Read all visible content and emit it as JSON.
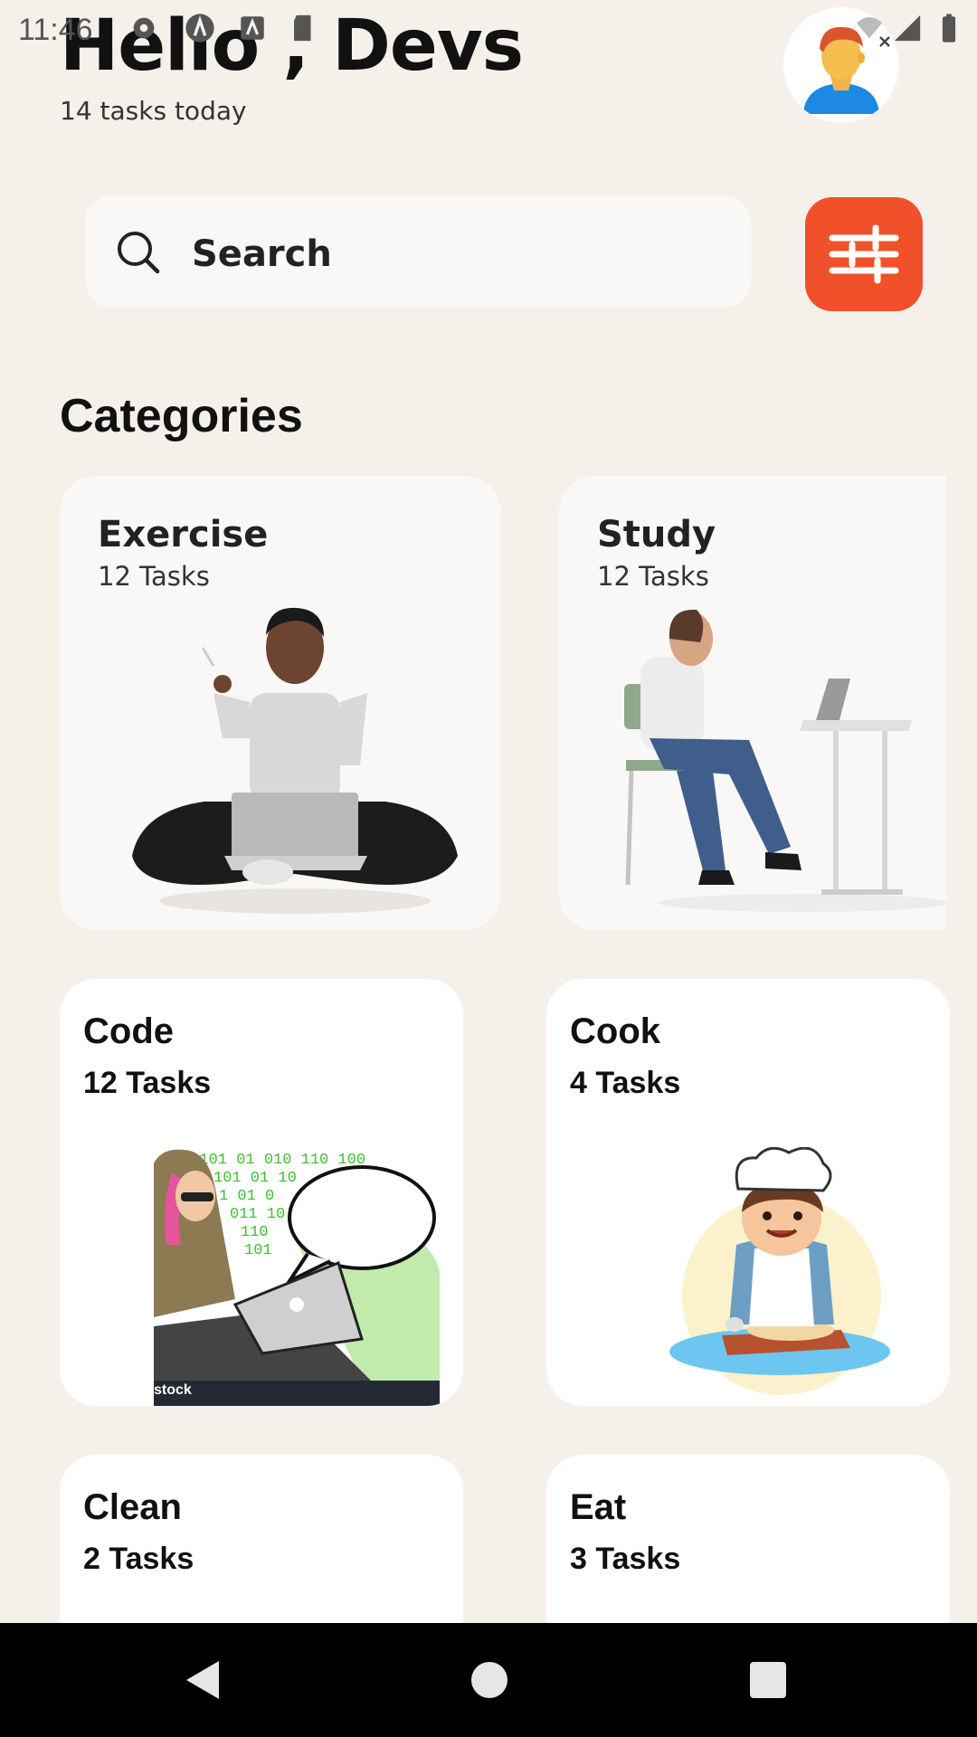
{
  "status_bar": {
    "time": "11:46",
    "icons": [
      "gear-icon",
      "a-badge-icon",
      "a-square-icon",
      "sd-card-icon",
      "wifi-icon",
      "cell-signal-icon",
      "battery-icon"
    ]
  },
  "header": {
    "greeting": "Hello , Devs",
    "subtitle": "14 tasks today",
    "avatar_icon": "user-avatar-icon"
  },
  "search": {
    "placeholder": "Search",
    "icon": "search-icon",
    "filter_icon": "sliders-icon"
  },
  "section": {
    "title": "Categories"
  },
  "categories": [
    {
      "title": "Exercise",
      "count": "12 Tasks"
    },
    {
      "title": "Study",
      "count": "12 Tasks"
    },
    {
      "title": "Code",
      "count": "12 Tasks"
    },
    {
      "title": "Cook",
      "count": "4 Tasks"
    },
    {
      "title": "Clean",
      "count": "2 Tasks"
    },
    {
      "title": "Eat",
      "count": "3 Tasks"
    }
  ],
  "watermark": "stock",
  "code_art": {
    "binary_lines": [
      ".0101 01 010 110 100",
      "101 01 10",
      "1 01 0",
      "011 10",
      "110",
      "101"
    ]
  },
  "colors": {
    "background": "#f5f0ea",
    "accent": "#f0512a",
    "card": "#ffffff",
    "nav_bar": "#000000"
  },
  "nav_bar": {
    "back_icon": "back-triangle-icon",
    "home_icon": "home-circle-icon",
    "recents_icon": "recents-square-icon"
  }
}
